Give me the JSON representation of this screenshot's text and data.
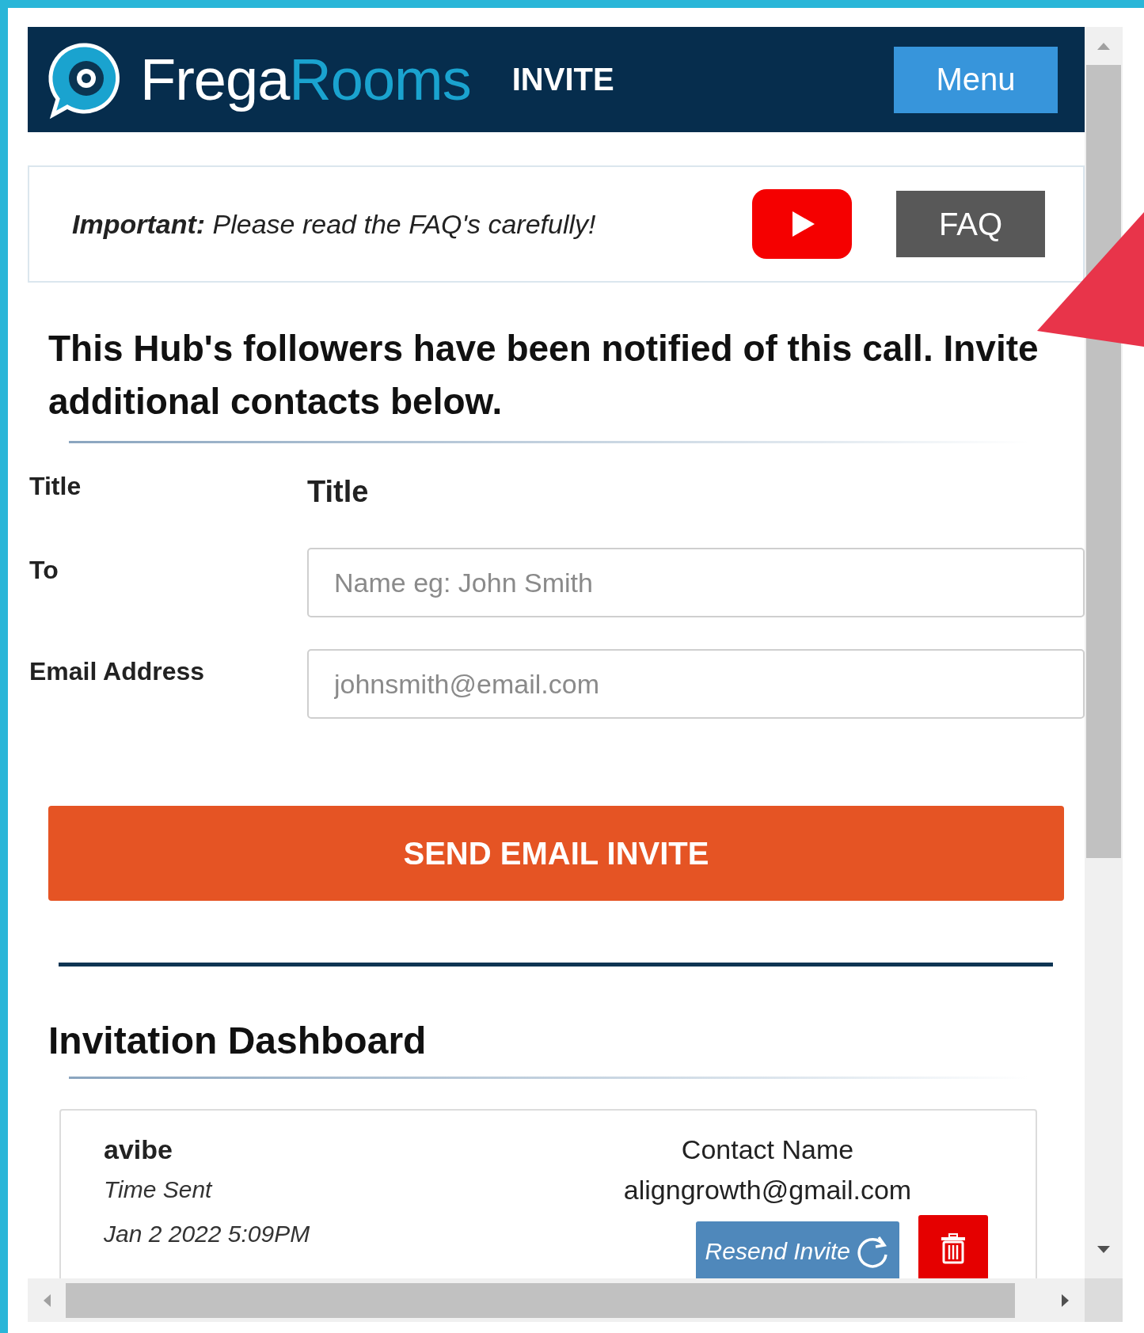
{
  "header": {
    "brand": [
      "Frega",
      "Rooms"
    ],
    "page_label": "INVITE",
    "menu_button": "Menu"
  },
  "notice": {
    "text": "**Important:** Please read the FAQ's carefully!",
    "faq_button": "FAQ"
  },
  "intro": "This Hub's followers have been notified of this call. Invite additional contacts below.",
  "form": {
    "fields": [
      {
        "kind": "static",
        "label": "Title",
        "value": "Title"
      },
      {
        "kind": "input",
        "label": "To",
        "placeholder": "Name eg: John Smith"
      },
      {
        "kind": "input",
        "label": "Email Address",
        "placeholder": "johnsmith@email.com"
      }
    ],
    "submit": "SEND EMAIL INVITE"
  },
  "dashboard": {
    "title": "Invitation Dashboard",
    "invites": [
      {
        "name": "avibe",
        "time_label": "Time Sent",
        "time": "Jan 2 2022 5:09PM",
        "contact_name": "Contact Name",
        "email": "aligngrowth@gmail.com",
        "resend_button": "Resend Invite"
      }
    ]
  }
}
